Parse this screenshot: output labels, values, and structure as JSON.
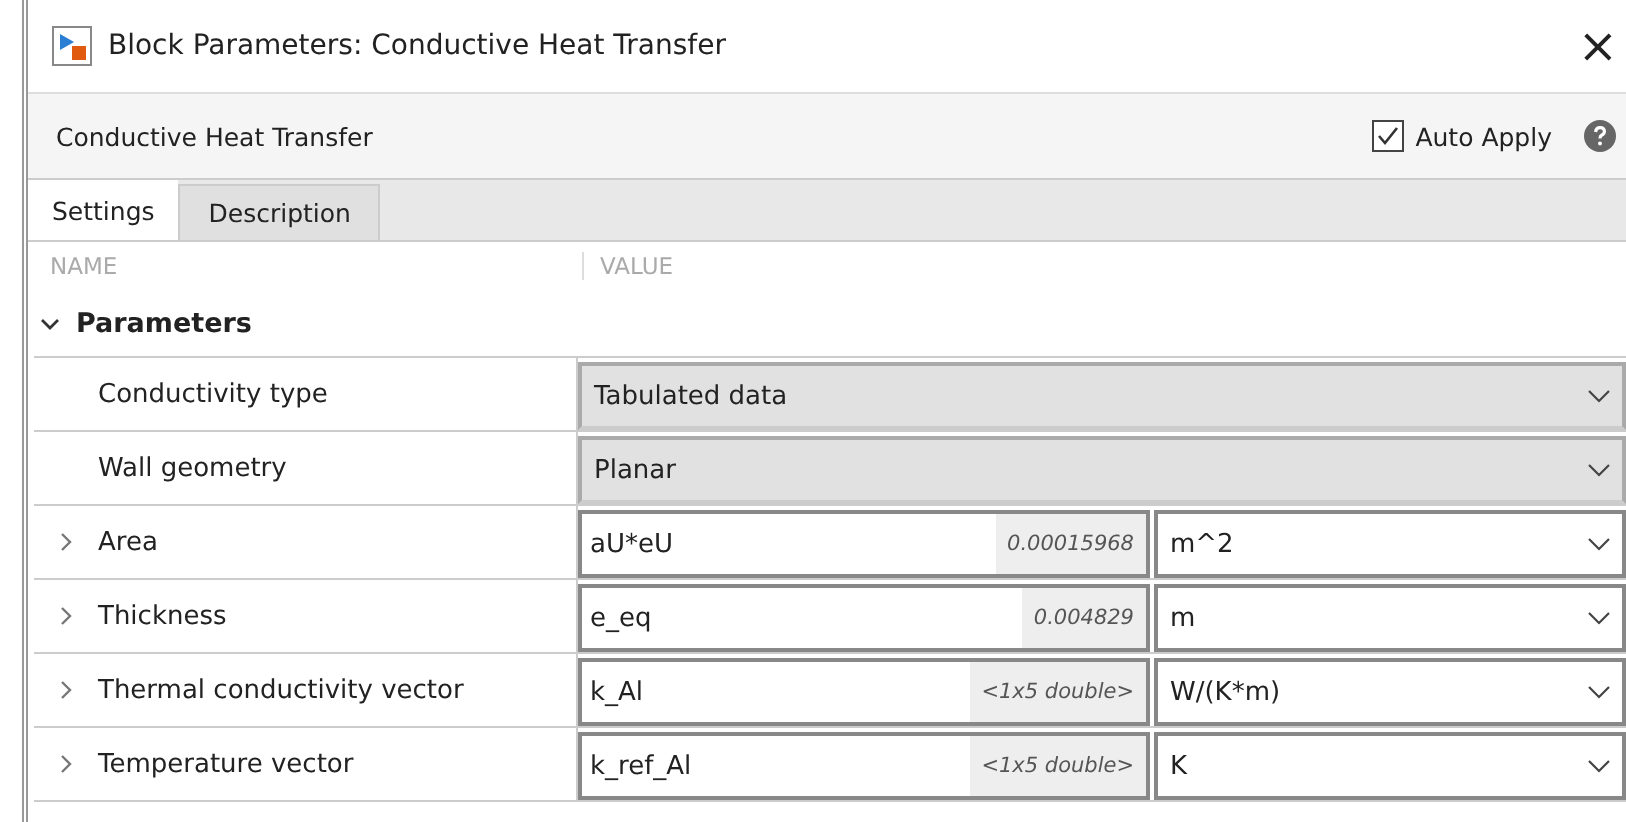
{
  "window": {
    "title": "Block Parameters: Conductive Heat Transfer",
    "close": "×"
  },
  "header": {
    "block_name": "Conductive Heat Transfer",
    "auto_apply": {
      "label": "Auto Apply",
      "checked": true
    }
  },
  "tabs": [
    {
      "label": "Settings",
      "selected": true
    },
    {
      "label": "Description",
      "selected": false
    }
  ],
  "columns": [
    "NAME",
    "VALUE"
  ],
  "section": {
    "label": "Parameters",
    "expanded": true
  },
  "rows": [
    {
      "kind": "dropdown",
      "name": "Conductivity type",
      "value": "Tabulated data"
    },
    {
      "kind": "dropdown",
      "name": "Wall geometry",
      "value": "Planar"
    },
    {
      "kind": "value_unit",
      "name": "Area",
      "expanded": false,
      "value": "aU*eU",
      "evaluated": "0.00015968",
      "unit": "m^2"
    },
    {
      "kind": "value_unit",
      "name": "Thickness",
      "expanded": false,
      "value": "e_eq",
      "evaluated": "0.004829",
      "unit": "m"
    },
    {
      "kind": "value_unit",
      "name": "Thermal conductivity vector",
      "expanded": false,
      "value": "k_Al",
      "evaluated": "<1x5 double>",
      "unit": "W/(K*m)"
    },
    {
      "kind": "value_unit",
      "name": "Temperature vector",
      "expanded": false,
      "value": "k_ref_Al",
      "evaluated": "<1x5 double>",
      "unit": "K"
    }
  ]
}
